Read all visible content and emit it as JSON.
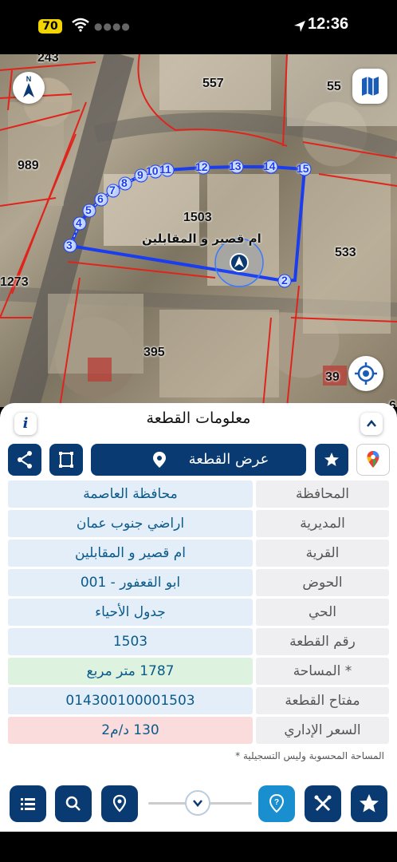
{
  "status_bar": {
    "battery": "70",
    "time": "12:36"
  },
  "map": {
    "parcel_numbers": [
      "243",
      "557",
      "55",
      "989",
      "1273",
      "1503",
      "533",
      "395",
      "39",
      "6"
    ],
    "selected_parcel_name": "ام قصير و المقابلين",
    "vertex_labels": [
      "2",
      "3",
      "4",
      "5",
      "6",
      "7",
      "8",
      "9",
      "10",
      "11",
      "12",
      "13",
      "14",
      "15"
    ]
  },
  "panel": {
    "title": "معلومات القطعة",
    "info_icon": "i",
    "view_parcel_label": "عرض القطعة",
    "rows": [
      {
        "label": "المحافظة",
        "value": "محافظة العاصمة"
      },
      {
        "label": "المديرية",
        "value": "اراضي جنوب عمان"
      },
      {
        "label": "القرية",
        "value": "ام قصير و المقابلين"
      },
      {
        "label": "الحوض",
        "value": "ابو القعفور - 001"
      },
      {
        "label": "الحي",
        "value": "جدول الأحياء"
      },
      {
        "label": "رقم القطعة",
        "value": "1503"
      },
      {
        "label": "المساحة *",
        "value": "1787  متر مربع"
      },
      {
        "label": "مفتاح القطعة",
        "value": "014300100001503"
      },
      {
        "label": "السعر الإداري",
        "value": "130 د/م2"
      }
    ],
    "footnote": "* المساحة المحسوبة وليس التسجيلية"
  },
  "colors": {
    "primary": "#0a3a72",
    "value_blue_bg": "#e3eef8",
    "value_green_bg": "#def3df",
    "value_red_bg": "#fadcdc",
    "parcel_line": "#e0241c",
    "selection_line": "#1b3df0",
    "help_accent": "#1a8fd0"
  },
  "icons": {
    "wifi": "wifi-icon",
    "location": "location-arrow-icon",
    "compass": "compass-north-icon",
    "layers": "map-layers-icon",
    "locate": "locate-icon",
    "share": "share-icon",
    "select": "selection-frame-icon",
    "pin": "map-pin-icon",
    "star": "star-icon",
    "google_maps": "google-maps-icon",
    "list": "list-icon",
    "search": "search-icon",
    "place": "place-icon",
    "chevron": "chevron-down-icon",
    "help": "help-pin-icon",
    "tools": "tools-icon",
    "favorites": "favorites-star-icon"
  }
}
